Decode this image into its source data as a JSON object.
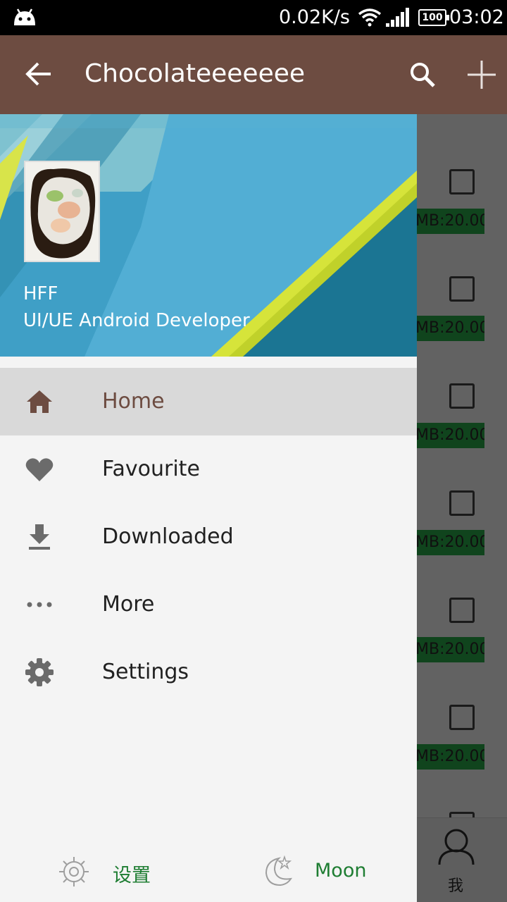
{
  "status_bar": {
    "speed": "0.02K/s",
    "battery": "100",
    "time": "03:02"
  },
  "app_bar": {
    "title": "Chocolateeeeeee"
  },
  "background_list": {
    "size_label": "MB:20.00",
    "rows": 7
  },
  "bottom_nav": {
    "me_label": "我"
  },
  "drawer": {
    "user_name": "HFF",
    "user_role": "UI/UE Android Developer",
    "menu": [
      {
        "label": "Home",
        "icon": "home-icon",
        "active": true
      },
      {
        "label": "Favourite",
        "icon": "heart-icon",
        "active": false
      },
      {
        "label": "Downloaded",
        "icon": "download-icon",
        "active": false
      },
      {
        "label": "More",
        "icon": "more-icon",
        "active": false
      },
      {
        "label": "Settings",
        "icon": "settings-icon",
        "active": false
      }
    ],
    "footer": {
      "settings_label": "设置",
      "moon_label": "Moon"
    }
  },
  "colors": {
    "primary": "#6d4c41",
    "accent_green": "#1e7d32",
    "size_badge": "#1b6e2f"
  }
}
